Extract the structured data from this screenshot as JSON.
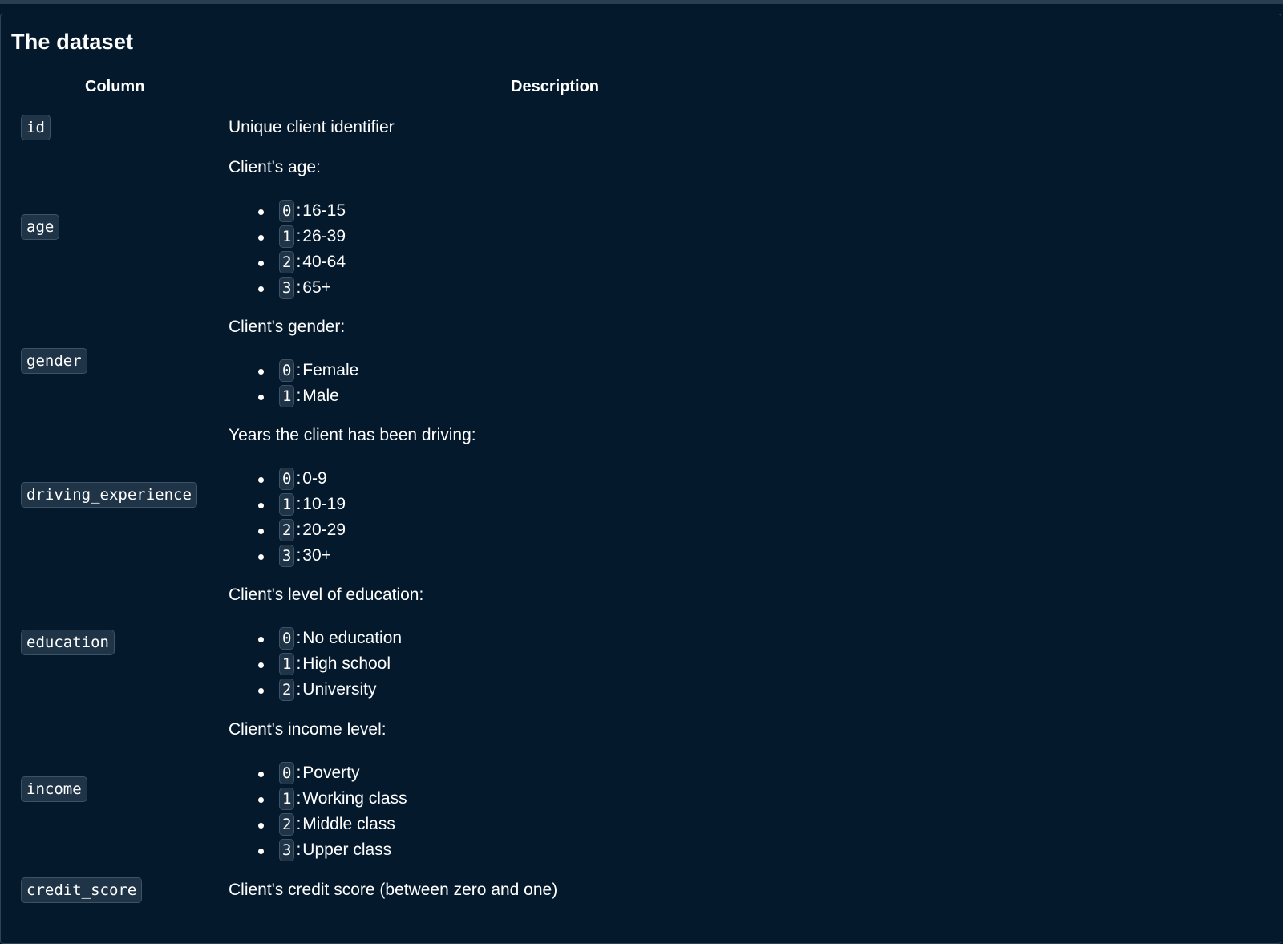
{
  "title": "The dataset",
  "headers": {
    "column": "Column",
    "description": "Description"
  },
  "rows": {
    "id": {
      "column": "id",
      "description": "Unique client identifier"
    },
    "age": {
      "column": "age",
      "description": "Client's age:",
      "options": [
        {
          "code": "0",
          "label": "16-15"
        },
        {
          "code": "1",
          "label": "26-39"
        },
        {
          "code": "2",
          "label": "40-64"
        },
        {
          "code": "3",
          "label": "65+"
        }
      ]
    },
    "gender": {
      "column": "gender",
      "description": "Client's gender:",
      "options": [
        {
          "code": "0",
          "label": "Female"
        },
        {
          "code": "1",
          "label": "Male"
        }
      ]
    },
    "driving_experience": {
      "column": "driving_experience",
      "description": "Years the client has been driving:",
      "options": [
        {
          "code": "0",
          "label": "0-9"
        },
        {
          "code": "1",
          "label": "10-19"
        },
        {
          "code": "2",
          "label": "20-29"
        },
        {
          "code": "3",
          "label": "30+"
        }
      ]
    },
    "education": {
      "column": "education",
      "description": "Client's level of education:",
      "options": [
        {
          "code": "0",
          "label": "No education"
        },
        {
          "code": "1",
          "label": "High school"
        },
        {
          "code": "2",
          "label": "University"
        }
      ]
    },
    "income": {
      "column": "income",
      "description": "Client's income level:",
      "options": [
        {
          "code": "0",
          "label": "Poverty"
        },
        {
          "code": "1",
          "label": "Working class"
        },
        {
          "code": "2",
          "label": "Middle class"
        },
        {
          "code": "3",
          "label": "Upper class"
        }
      ]
    },
    "credit_score": {
      "column": "credit_score",
      "description": "Client's credit score (between zero and one)"
    }
  }
}
